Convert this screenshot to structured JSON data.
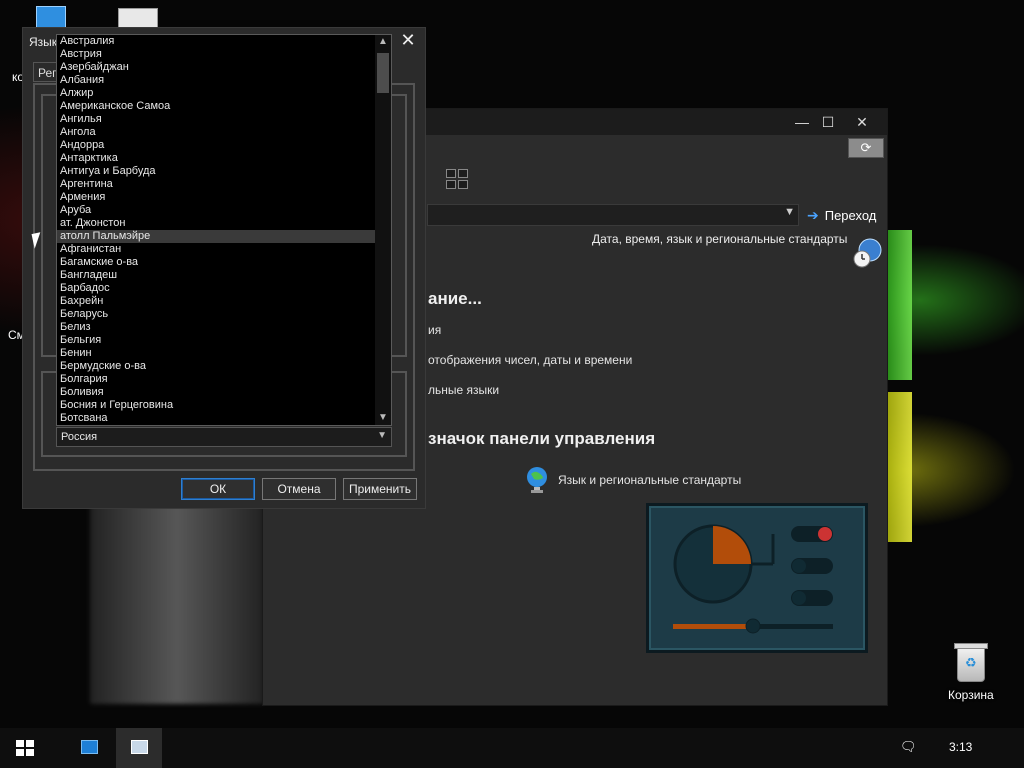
{
  "desktop": {
    "recycle_bin_label": "Корзина",
    "partial_labels": [
      "ко",
      "См"
    ]
  },
  "control_panel": {
    "go_label": "Переход",
    "breadcrumb": "Дата, время, язык и региональные стандарты",
    "heading_partial": "ание...",
    "text_lines": [
      "ия",
      "отображения чисел, даты и времени",
      "льные языки"
    ],
    "section_heading": "значок панели управления",
    "link_region": "Язык и региональные стандарты"
  },
  "region_dialog": {
    "title_partial": "Язык",
    "tab_partial": "Рег",
    "buttons": {
      "ok": "ОК",
      "cancel": "Отмена",
      "apply": "Применить"
    },
    "selected_value": "Россия",
    "list_items": [
      "Австралия",
      "Австрия",
      "Азербайджан",
      "Албания",
      "Алжир",
      "Американское Самоа",
      "Ангилья",
      "Ангола",
      "Андорра",
      "Антарктика",
      "Антигуа и Барбуда",
      "Аргентина",
      "Армения",
      "Аруба",
      "ат. Джонстон",
      "атолл Пальмэйре",
      "Афганистан",
      "Багамские о-ва",
      "Бангладеш",
      "Барбадос",
      "Бахрейн",
      "Беларусь",
      "Белиз",
      "Бельгия",
      "Бенин",
      "Бермудские о-ва",
      "Болгария",
      "Боливия",
      "Босния и Герцеговина",
      "Ботсвана"
    ],
    "hovered_index": 15
  },
  "taskbar": {
    "time": "3:13"
  }
}
